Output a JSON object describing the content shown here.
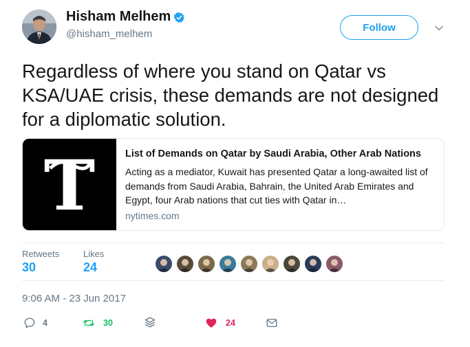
{
  "author": {
    "name": "Hisham Melhem",
    "handle": "@hisham_melhem",
    "verified": true,
    "verified_icon": "verified-badge-icon"
  },
  "follow_label": "Follow",
  "tweet_text": "Regardless of where you stand on Qatar vs KSA/UAE crisis, these demands are not designed for a diplomatic solution.",
  "card": {
    "title": "List of Demands on Qatar by Saudi Arabia, Other Arab Nations",
    "description": "Acting as a mediator, Kuwait has presented Qatar a long-awaited list of demands from Saudi Arabia, Bahrain, the United Arab Emirates and Egypt, four Arab nations that cut ties with Qatar in…",
    "domain": "nytimes.com",
    "image_icon": "nyt-t-logo"
  },
  "stats": {
    "retweets_label": "Retweets",
    "retweets": "30",
    "likes_label": "Likes",
    "likes": "24"
  },
  "likers": [
    {
      "color": "#3a4a6b"
    },
    {
      "color": "#5a4a3a"
    },
    {
      "color": "#7a6a4a"
    },
    {
      "color": "#3a7a9a"
    },
    {
      "color": "#8a7a5a"
    },
    {
      "color": "#c9b08a"
    },
    {
      "color": "#4a4a3a"
    },
    {
      "color": "#2a3a5a"
    },
    {
      "color": "#8a5a6a"
    }
  ],
  "timestamp": "9:06 AM - 23 Jun 2017",
  "actions": {
    "replies": "4",
    "retweets": "30",
    "likes": "24"
  },
  "colors": {
    "accent": "#1da1f2",
    "retweet": "#17bf63",
    "like": "#e0245e",
    "muted": "#657786",
    "border": "#e1e8ed"
  }
}
